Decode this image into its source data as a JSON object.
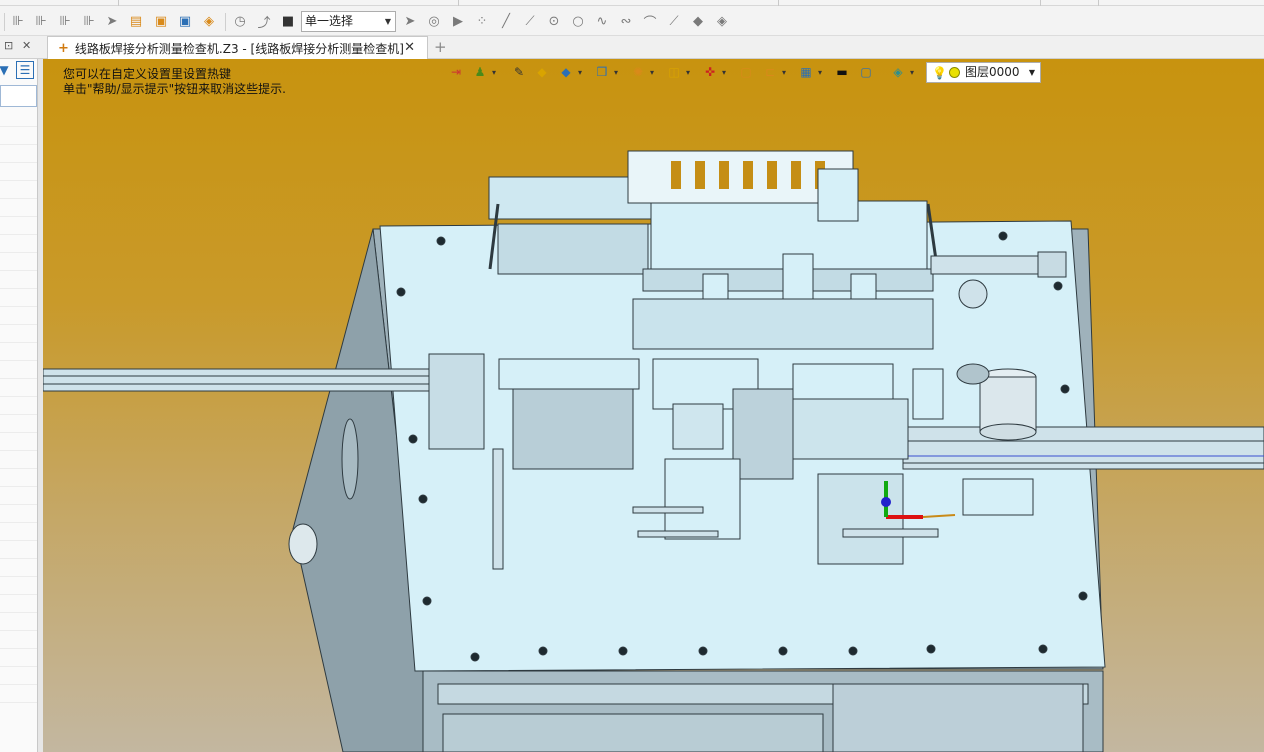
{
  "toolbar": {
    "icons": [
      "sketch-icon",
      "sketch-icon",
      "sketch-icon",
      "sketch-icon",
      "pointer-icon",
      "table-icon",
      "folder-icon",
      "save-icon",
      "export-icon",
      "measure-icon",
      "curve-icon",
      "stop-icon"
    ],
    "filter_select": {
      "value": "单一选择"
    },
    "snap_icons": [
      "pick-icon",
      "filter-icon",
      "play-icon",
      "points-icon",
      "line-icon",
      "line-icon",
      "circle-icon",
      "circle-icon",
      "spline-icon",
      "wave-icon",
      "arc-icon",
      "line-icon",
      "shape-icon",
      "shape-icon"
    ]
  },
  "tabs": {
    "document_tab": "线路板焊接分析测量检查机.Z3 - [线路板焊接分析测量检查机]",
    "new_tab_symbol": "+"
  },
  "viewport": {
    "hint_line1": "您可以在自定义设置里设置热键",
    "hint_line2": "单击\"帮助/显示提示\"按钮来取消这些提示.",
    "layer_select": {
      "value": "图层0000"
    },
    "background_top_color": "#c8930f",
    "background_bottom_color": "#c3b7a0",
    "model_color": "#d6f0f8"
  }
}
